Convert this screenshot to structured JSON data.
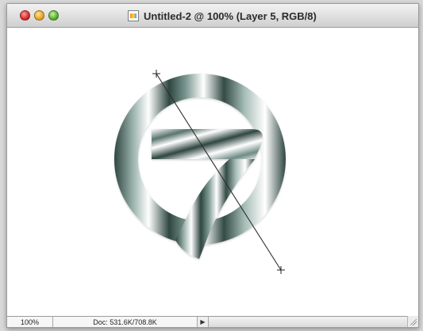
{
  "window": {
    "title": "Untitled-2 @ 100% (Layer 5, RGB/8)",
    "controls": {
      "close_icon": "close-icon",
      "minimize_icon": "minimize-icon",
      "zoom_icon": "zoom-icon"
    },
    "document_icon": "document-icon"
  },
  "canvas": {
    "artwork_icon": "gradient-circle-seven-artwork",
    "gradient_handles": [
      "start-handle-icon",
      "end-handle-icon"
    ]
  },
  "status": {
    "zoom_level": "100%",
    "doc_size": "Doc: 531.6K/708.8K",
    "menu_arrow": "▶"
  },
  "colors": {
    "metal_dark": "#2f4640",
    "metal_mid": "#6f8b85",
    "metal_light": "#ffffff",
    "titlebar": "#d7d7d7",
    "statusbar": "#e7e7e7"
  }
}
